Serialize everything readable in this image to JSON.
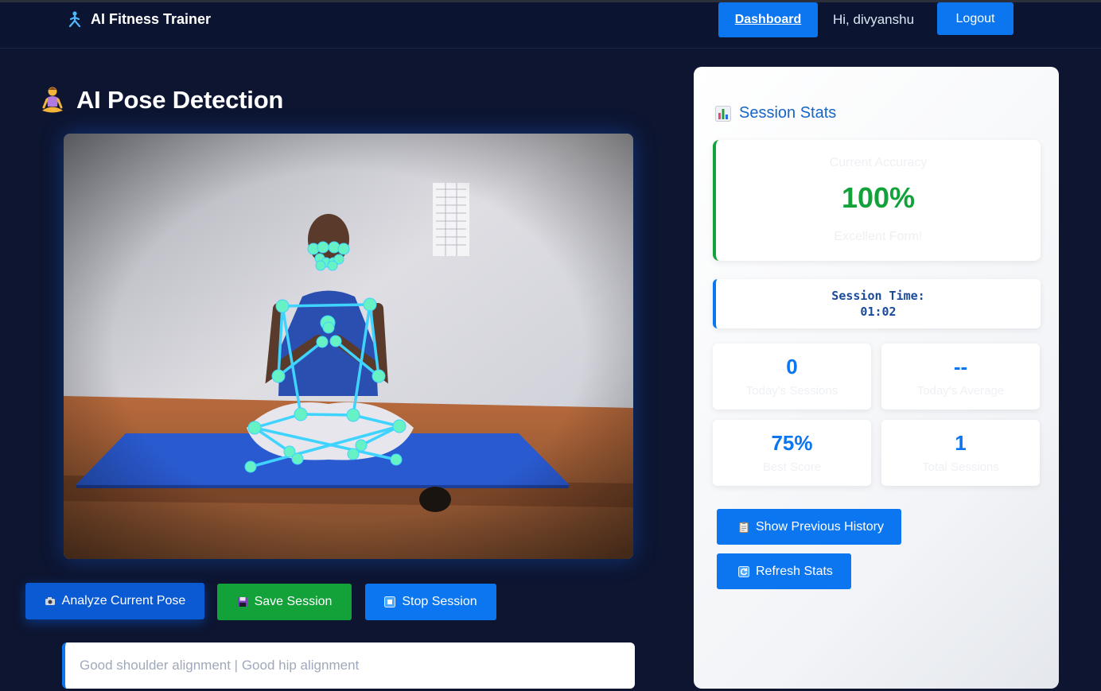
{
  "navbar": {
    "brand": "AI Fitness Trainer",
    "brand_icon": "person-figure-icon",
    "dashboard_label": "Dashboard",
    "greeting": "Hi, divyanshu",
    "logout_label": "Logout"
  },
  "main": {
    "title": "AI Pose Detection",
    "title_icon": "meditation-emoji-icon",
    "video_alt": "webcam-feed-with-pose-skeleton",
    "buttons": {
      "analyze": "Analyze Current Pose",
      "save": "Save Session",
      "stop": "Stop Session"
    },
    "feedback": "Good shoulder alignment | Good hip alignment"
  },
  "stats": {
    "title": "Session Stats",
    "accuracy_label": "Current Accuracy",
    "accuracy_value": "100%",
    "accuracy_sub": "Excellent Form!",
    "session_time_label": "Session Time:",
    "session_time_value": "01:02",
    "cards": [
      {
        "value": "0",
        "label": "Today's Sessions"
      },
      {
        "value": "--",
        "label": "Today's Average"
      },
      {
        "value": "75%",
        "label": "Best Score"
      },
      {
        "value": "1",
        "label": "Total Sessions"
      }
    ],
    "history_button": "Show Previous History",
    "refresh_button": "Refresh Stats"
  },
  "colors": {
    "background": "#0d1530",
    "primary": "#0b76ef",
    "success": "#13a13a",
    "skeleton": "#3fd3ff",
    "keypoint": "#66f2c4"
  }
}
